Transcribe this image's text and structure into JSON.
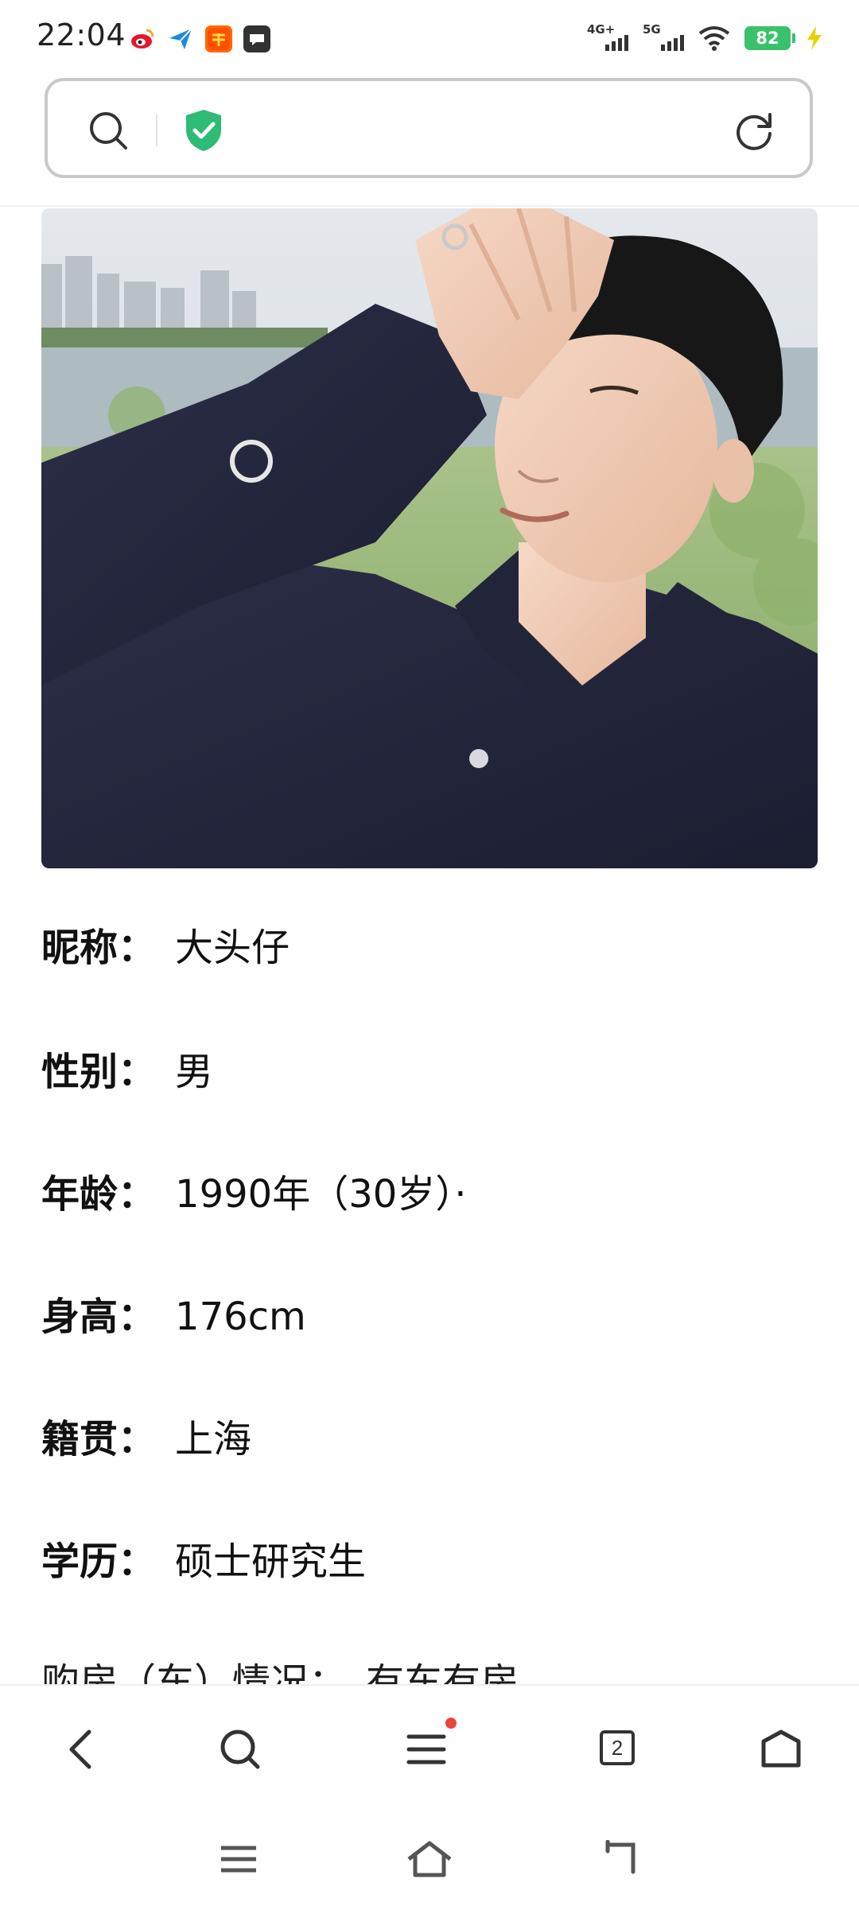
{
  "status_bar": {
    "time": "22:04",
    "notification_icons": [
      "weibo-icon",
      "send-icon",
      "taobao-icon",
      "message-icon"
    ],
    "network_1": "4G+",
    "network_2": "5G",
    "battery": "82"
  },
  "address_bar": {
    "search_icon": "search-icon",
    "security_icon": "shield-check-icon",
    "refresh_icon": "refresh-icon",
    "shield_color": "#2dbb75"
  },
  "profile": {
    "photo": "profile-photo",
    "fields": [
      {
        "label": "昵称",
        "colon": "：",
        "value": "大头仔"
      },
      {
        "label": "性别",
        "colon": "：",
        "value": "男"
      },
      {
        "label": "年龄",
        "colon": "：",
        "value": "1990年（30岁）·"
      },
      {
        "label": "身高",
        "colon": "：",
        "value": "176cm"
      },
      {
        "label": "籍贯",
        "colon": "：",
        "value": "上海"
      },
      {
        "label": "学历",
        "colon": "：",
        "value": "硕士研究生"
      },
      {
        "label": "购房（车）情况",
        "colon": "：",
        "value": "有车有房"
      }
    ]
  },
  "browser_toolbar": {
    "back": "back-icon",
    "search": "search-icon",
    "menu": "menu-icon",
    "tab_count": "2",
    "home": "home-icon",
    "accent": "#e8453c"
  },
  "system_nav": {
    "recents": "recents-icon",
    "home": "home-icon",
    "back": "back-icon"
  }
}
